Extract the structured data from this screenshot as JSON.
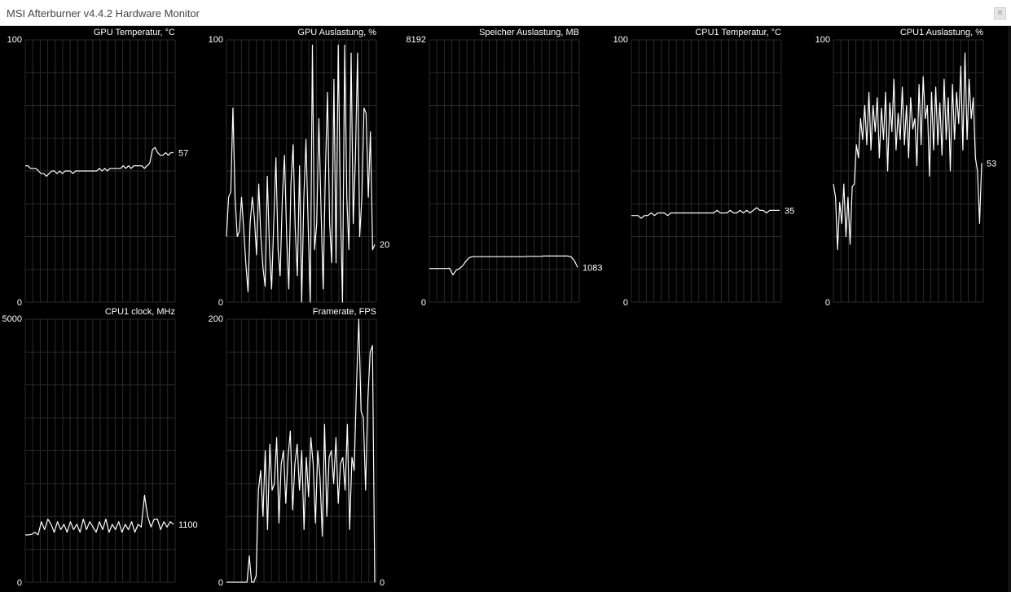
{
  "window": {
    "title": "MSI Afterburner v4.4.2 Hardware Monitor",
    "close_icon": "close-icon"
  },
  "colors": {
    "background": "#000000",
    "grid": "#2a2a2a",
    "trace": "#ffffff",
    "titlebar": "#ffffff"
  },
  "graphs": [
    {
      "name": "GPU Temperatur, °C",
      "max": "100",
      "min": "0",
      "current": "57",
      "trace": [
        52,
        52,
        51,
        51,
        51,
        50,
        49,
        49,
        48,
        49,
        50,
        50,
        49,
        50,
        49,
        50,
        50,
        50,
        49,
        50,
        50,
        50,
        50,
        50,
        50,
        50,
        50,
        50,
        51,
        50,
        51,
        50,
        51,
        51,
        51,
        51,
        51,
        52,
        51,
        52,
        51,
        52,
        52,
        52,
        52,
        51,
        52,
        53,
        58,
        59,
        57,
        56,
        56,
        57,
        56,
        57,
        57
      ]
    },
    {
      "name": "GPU Auslastung, %",
      "max": "100",
      "min": "0",
      "current": "20",
      "trace": [
        25,
        40,
        42,
        74,
        40,
        25,
        27,
        40,
        28,
        15,
        4,
        30,
        40,
        32,
        18,
        45,
        25,
        13,
        6,
        48,
        20,
        5,
        30,
        55,
        20,
        10,
        40,
        56,
        25,
        5,
        45,
        60,
        28,
        10,
        52,
        0,
        40,
        62,
        30,
        0,
        98,
        20,
        30,
        70,
        35,
        5,
        48,
        80,
        30,
        15,
        85,
        15,
        98,
        38,
        0,
        98,
        40,
        20,
        95,
        30,
        55,
        95,
        25,
        40,
        74,
        72,
        40,
        65,
        20,
        22
      ]
    },
    {
      "name": "Speicher Auslastung, MB",
      "max": "8192",
      "min": "0",
      "current": "1083",
      "trace": [
        1050,
        1050,
        1050,
        1050,
        1050,
        1050,
        1060,
        850,
        1000,
        1050,
        1150,
        1300,
        1400,
        1420,
        1420,
        1420,
        1420,
        1420,
        1420,
        1420,
        1420,
        1420,
        1420,
        1420,
        1420,
        1420,
        1420,
        1420,
        1420,
        1430,
        1430,
        1430,
        1430,
        1430,
        1440,
        1440,
        1440,
        1440,
        1440,
        1440,
        1440,
        1440,
        1420,
        1300,
        1083
      ]
    },
    {
      "name": "CPU1 Temperatur, °C",
      "max": "100",
      "min": "0",
      "current": "35",
      "trace": [
        33,
        33,
        33,
        32,
        33,
        33,
        34,
        33,
        34,
        34,
        34,
        33,
        34,
        34,
        34,
        34,
        34,
        34,
        34,
        34,
        34,
        34,
        34,
        34,
        34,
        34,
        35,
        34,
        34,
        34,
        35,
        34,
        34,
        35,
        34,
        35,
        34,
        35,
        36,
        35,
        35,
        34,
        35,
        35,
        35,
        35
      ]
    },
    {
      "name": "CPU1 Auslastung, %",
      "max": "100",
      "min": "0",
      "current": "53",
      "trace": [
        45,
        40,
        20,
        38,
        30,
        45,
        25,
        40,
        22,
        44,
        45,
        60,
        55,
        70,
        62,
        75,
        60,
        80,
        58,
        75,
        65,
        78,
        55,
        74,
        62,
        80,
        50,
        76,
        65,
        85,
        58,
        72,
        62,
        82,
        60,
        75,
        55,
        78,
        66,
        70,
        52,
        83,
        60,
        86,
        70,
        75,
        48,
        80,
        58,
        82,
        60,
        76,
        56,
        85,
        62,
        78,
        50,
        83,
        62,
        80,
        68,
        90,
        58,
        95,
        62,
        85,
        70,
        78,
        55,
        50,
        30,
        53
      ]
    },
    {
      "name": "CPU1 clock, MHz",
      "max": "5000",
      "min": "0",
      "current": "1100",
      "trace": [
        900,
        900,
        910,
        950,
        900,
        1150,
        1000,
        1200,
        1100,
        950,
        1150,
        1000,
        1100,
        950,
        1150,
        1000,
        1100,
        950,
        1200,
        1000,
        1150,
        1050,
        950,
        1150,
        1000,
        1200,
        950,
        1100,
        1000,
        1150,
        950,
        1100,
        1000,
        1150,
        950,
        1100,
        1050,
        1650,
        1250,
        1050,
        1200,
        1200,
        1000,
        1150,
        1050,
        1150,
        1100
      ]
    },
    {
      "name": "Framerate, FPS",
      "max": "200",
      "min": "0",
      "current": "0",
      "trace": [
        0,
        0,
        0,
        0,
        0,
        0,
        0,
        0,
        0,
        0,
        20,
        0,
        0,
        5,
        70,
        85,
        50,
        100,
        40,
        105,
        70,
        75,
        110,
        45,
        90,
        100,
        60,
        95,
        115,
        55,
        90,
        105,
        70,
        100,
        40,
        95,
        65,
        110,
        90,
        45,
        100,
        80,
        35,
        120,
        50,
        95,
        100,
        75,
        110,
        60,
        90,
        95,
        70,
        120,
        40,
        95,
        85,
        150,
        200,
        130,
        125,
        70,
        140,
        175,
        180,
        0
      ]
    }
  ]
}
